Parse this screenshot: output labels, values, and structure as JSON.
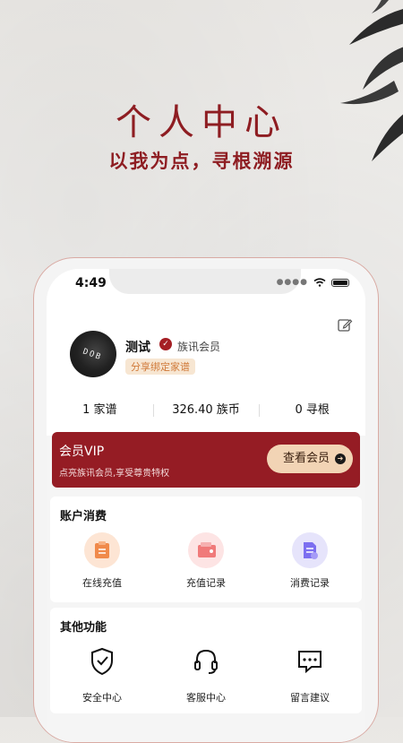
{
  "hero": {
    "title": "个人中心",
    "subtitle": "以我为点，寻根溯源"
  },
  "status_bar": {
    "time": "4:49"
  },
  "profile": {
    "username": "测试",
    "member_label": "族讯会员",
    "bind_tag": "分享绑定家谱",
    "avatar_text": "DOB"
  },
  "stats": [
    {
      "label": "1 家谱"
    },
    {
      "label": "326.40 族币"
    },
    {
      "label": "0 寻根"
    }
  ],
  "vip": {
    "title": "会员VIP",
    "description": "点亮族讯会员,享受尊贵特权",
    "button": "查看会员"
  },
  "account": {
    "title": "账户消费",
    "items": [
      {
        "label": "在线充值",
        "icon": "recharge-icon"
      },
      {
        "label": "充值记录",
        "icon": "wallet-icon"
      },
      {
        "label": "消费记录",
        "icon": "document-icon"
      }
    ]
  },
  "other": {
    "title": "其他功能",
    "items": [
      {
        "label": "安全中心",
        "icon": "shield-icon"
      },
      {
        "label": "客服中心",
        "icon": "headset-icon"
      },
      {
        "label": "留言建议",
        "icon": "chat-icon"
      }
    ]
  },
  "colors": {
    "accent": "#951c24",
    "gold": "#f2d4b5"
  }
}
